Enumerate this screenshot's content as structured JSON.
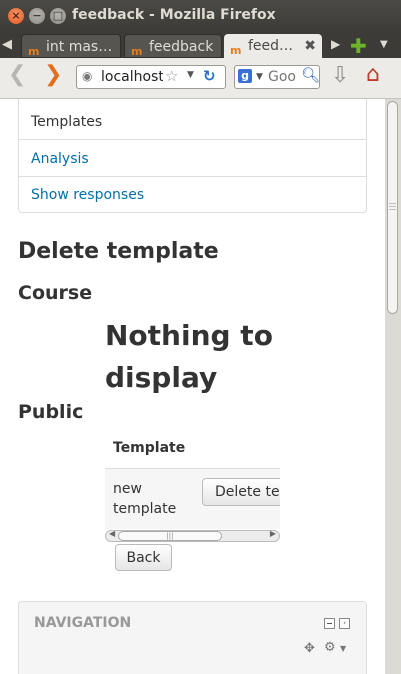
{
  "window": {
    "title": "feedback - Mozilla Firefox"
  },
  "tabs": [
    {
      "label": "int mas…",
      "active": false
    },
    {
      "label": "feedback",
      "active": false
    },
    {
      "label": "feed…",
      "active": true
    }
  ],
  "toolbar": {
    "url": "localhost",
    "search_placeholder": "Goo"
  },
  "block_menu": {
    "items": [
      {
        "label": "Templates",
        "type": "current"
      },
      {
        "label": "Analysis",
        "type": "link"
      },
      {
        "label": "Show responses",
        "type": "link"
      }
    ]
  },
  "main": {
    "heading": "Delete template",
    "course_heading": "Course",
    "nothing_to_display": "Nothing to display",
    "public_heading": "Public",
    "table": {
      "header": "Template",
      "rows": [
        {
          "name": "new template",
          "action": "Delete template"
        }
      ]
    },
    "back_button": "Back"
  },
  "navigation_block": {
    "title": "NAVIGATION"
  },
  "colors": {
    "link": "#0070a8",
    "firefox_orange": "#e46c1a"
  }
}
